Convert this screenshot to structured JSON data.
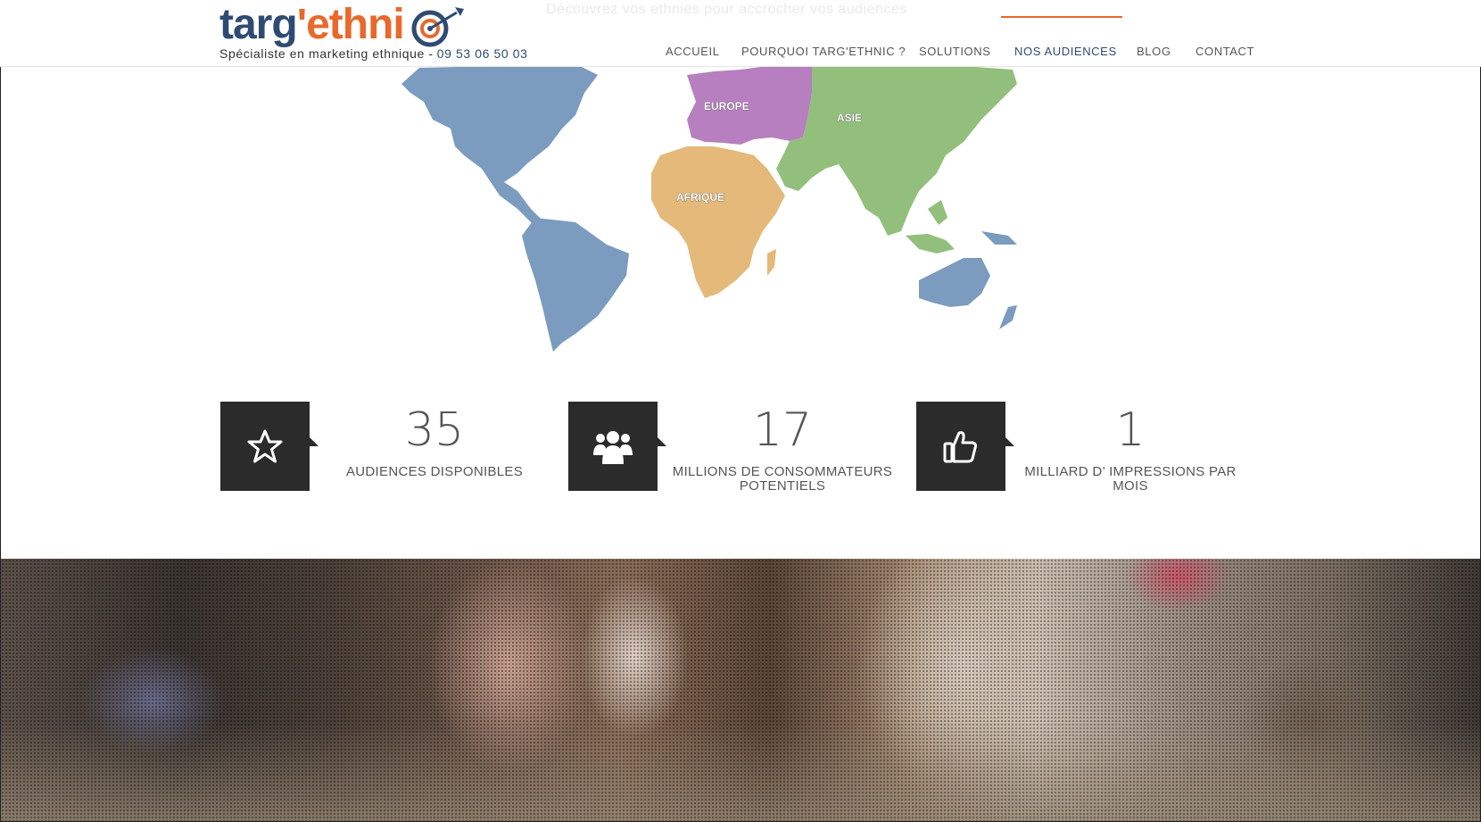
{
  "header": {
    "ghost_text": "Découvrez vos ethnies pour accrocher vos audiences",
    "logo": {
      "part1": "targ",
      "apostrophe": "'",
      "part2": "ethni"
    },
    "tagline": "Spécialiste en marketing ethnique -",
    "phone": "09 53 06 50 03",
    "nav": [
      {
        "label": "ACCUEIL"
      },
      {
        "label": "POURQUOI TARG'ETHNIC ?"
      },
      {
        "label": "SOLUTIONS"
      },
      {
        "label": "NOS AUDIENCES"
      },
      {
        "label": "BLOG"
      },
      {
        "label": "CONTACT"
      }
    ]
  },
  "map": {
    "regions": [
      {
        "label": "EUROPE",
        "color": "#b77fc0"
      },
      {
        "label": "ASIE",
        "color": "#93bf7c"
      },
      {
        "label": "AFRIQUE",
        "color": "#e4b97a"
      },
      {
        "label": "",
        "color": "#7b9bbf"
      }
    ]
  },
  "stats": [
    {
      "icon": "star-icon",
      "number": "35",
      "label": "AUDIENCES DISPONIBLES"
    },
    {
      "icon": "users-icon",
      "number": "17",
      "label": "MILLIONS DE CONSOMMATEURS POTENTIELS"
    },
    {
      "icon": "thumbs-up-icon",
      "number": "1",
      "label": "MILLIARD D’ IMPRESSIONS PAR MOIS"
    }
  ],
  "colors": {
    "brand_blue": "#2f4b73",
    "brand_orange": "#e8692c",
    "icon_box": "#2b2b2b"
  }
}
